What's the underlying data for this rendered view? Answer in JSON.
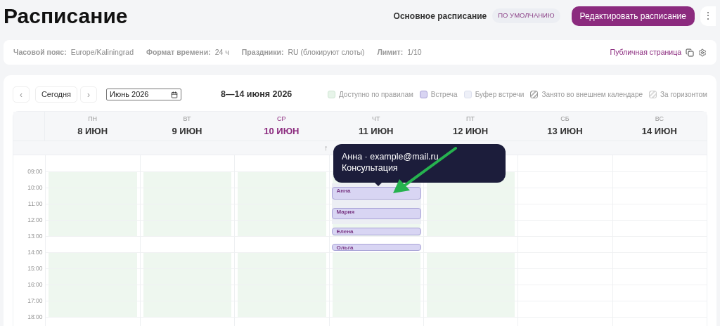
{
  "header": {
    "title": "Расписание",
    "schedule_name": "Основное расписание",
    "badge": "ПО УМОЛЧАНИЮ",
    "edit_button": "Редактировать расписание",
    "more_button": "⋮"
  },
  "info": {
    "fields": [
      {
        "label": "Часовой пояс:",
        "value": "Europe/Kaliningrad"
      },
      {
        "label": "Формат времени:",
        "value": "24 ч"
      },
      {
        "label": "Праздники:",
        "value": "RU (блокируют слоты)"
      },
      {
        "label": "Лимит:",
        "value": "1/10"
      }
    ],
    "public_link": "Публичная страница"
  },
  "toolbar": {
    "prev": "‹",
    "today": "Сегодня",
    "next": "›",
    "month": "Июнь 2026",
    "range": "8—14 июня 2026"
  },
  "legend": [
    {
      "kind": "available",
      "label": "Доступно по правилам"
    },
    {
      "kind": "meeting",
      "label": "Встреча"
    },
    {
      "kind": "buffer",
      "label": "Буфер встречи"
    },
    {
      "kind": "external",
      "label": "Занято во внешнем календаре"
    },
    {
      "kind": "horizon",
      "label": "За горизонтом"
    }
  ],
  "days": [
    {
      "weekday": "ПН",
      "date": "8 ИЮН",
      "today": false,
      "available": true
    },
    {
      "weekday": "ВТ",
      "date": "9 ИЮН",
      "today": false,
      "available": true
    },
    {
      "weekday": "СР",
      "date": "10 ИЮН",
      "today": true,
      "available": true
    },
    {
      "weekday": "ЧТ",
      "date": "11 ИЮН",
      "today": false,
      "available": true,
      "events": [
        {
          "name": "Анна"
        },
        {
          "name": "Мария"
        },
        {
          "name": "Елена"
        },
        {
          "name": "Ольга"
        }
      ]
    },
    {
      "weekday": "ПТ",
      "date": "12 ИЮН",
      "today": false,
      "available": true
    },
    {
      "weekday": "СБ",
      "date": "13 ИЮН",
      "today": false,
      "available": false
    },
    {
      "weekday": "ВС",
      "date": "14 ИЮН",
      "today": false,
      "available": false
    }
  ],
  "collapse_toggle": "↑",
  "hours": [
    "09:00",
    "10:00",
    "11:00",
    "12:00",
    "13:00",
    "14:00",
    "15:00",
    "16:00",
    "17:00",
    "18:00"
  ],
  "tooltip": {
    "lines": [
      "Анна · example@mail.ru",
      "Консультация"
    ]
  }
}
